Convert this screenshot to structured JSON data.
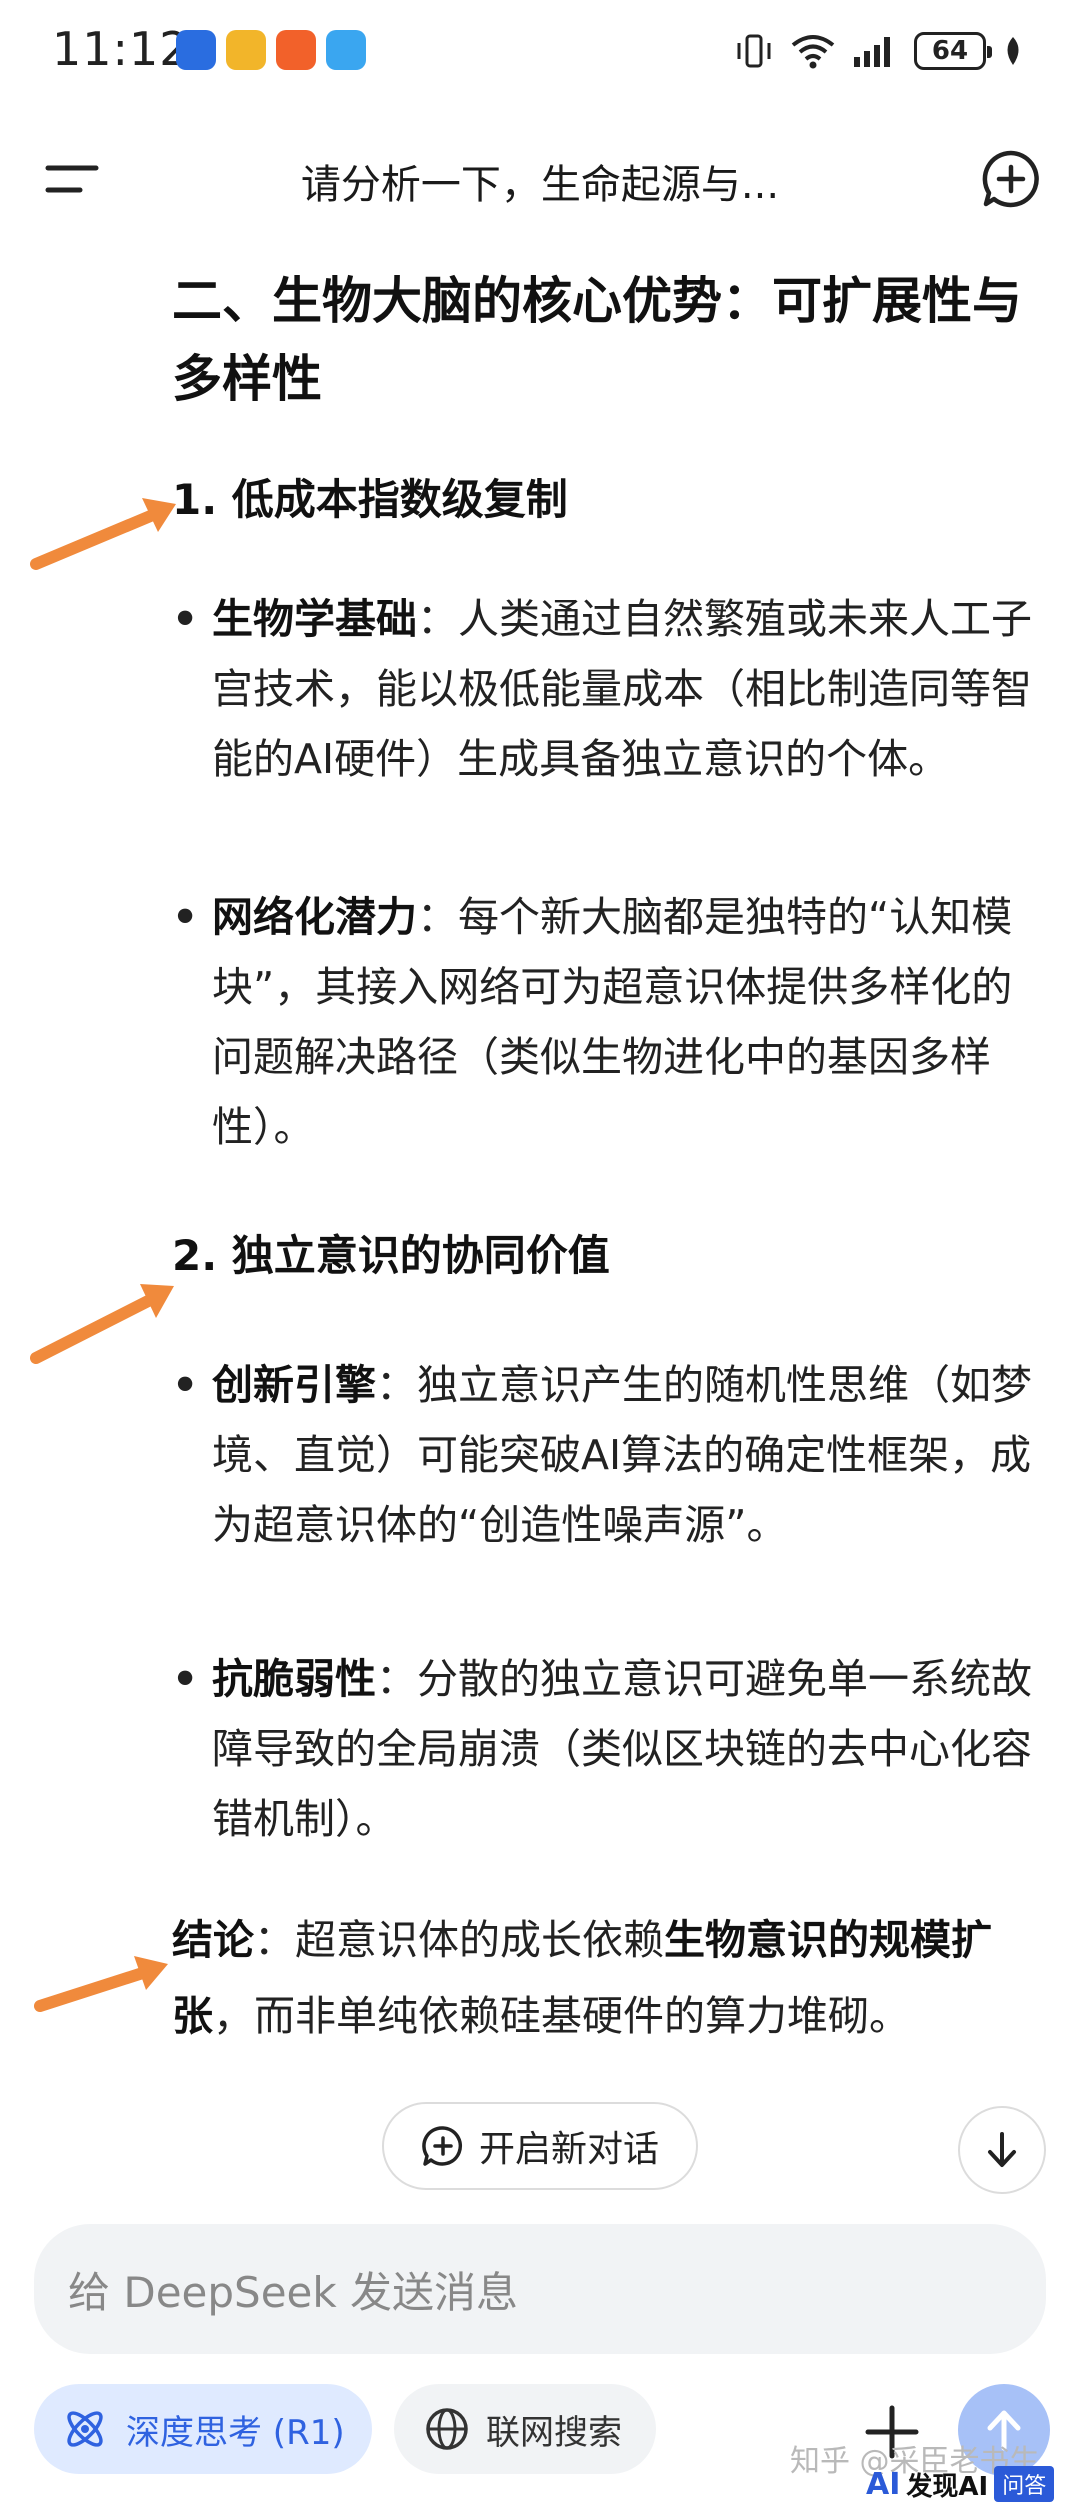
{
  "status_bar": {
    "time": "11:12",
    "battery": "64"
  },
  "header": {
    "title": "请分析一下，生命起源与..."
  },
  "section": {
    "title": "二、生物大脑的核心优势：可扩展性与多样性",
    "sub1": {
      "title": "1. 低成本指数级复制",
      "bullets": [
        {
          "bold": "生物学基础",
          "text": "：人类通过自然繁殖或未来人工子宫技术，能以极低能量成本（相比制造同等智能的AI硬件）生成具备独立意识的个体。"
        },
        {
          "bold": "网络化潜力",
          "text": "：每个新大脑都是独特的“认知模块”，其接入网络可为超意识体提供多样化的问题解决路径（类似生物进化中的基因多样性）。"
        }
      ]
    },
    "sub2": {
      "title": "2. 独立意识的协同价值",
      "bullets": [
        {
          "bold": "创新引擎",
          "text": "：独立意识产生的随机性思维（如梦境、直觉）可能突破AI算法的确定性框架，成为超意识体的“创造性噪声源”。"
        },
        {
          "bold": "抗脆弱性",
          "text": "：分散的独立意识可避免单一系统故障导致的全局崩溃（类似区块链的去中心化容错机制）。"
        }
      ]
    },
    "conclusion": {
      "label": "结论",
      "text_a": "：超意识体的成长依赖",
      "bold": "生物意识的规模扩张",
      "text_b": "，而非单纯依赖硅基硬件的算力堆砌。"
    }
  },
  "new_dialog_label": "开启新对话",
  "input": {
    "placeholder": "给 DeepSeek 发送消息"
  },
  "bottom": {
    "deep_think_label": "深度思考 (R1)",
    "web_search_label": "联网搜索"
  },
  "watermark": {
    "text": "知乎 @采臣老书生",
    "logo_ai": "AI",
    "logo_name": "发现AI",
    "logo_badge": "问答"
  },
  "colors": {
    "accent": "#2f62e0",
    "arrow": "#f08a3c",
    "chip_deep_bg": "#dfeaff",
    "send_bg": "#a7c1f7"
  },
  "icons": {
    "menu": "menu-icon",
    "new_chat": "new-chat-icon",
    "new_dialog": "chat-plus-icon",
    "scroll_down": "arrow-down-icon",
    "deep_think": "atom-icon",
    "web_search": "globe-icon",
    "plus": "plus-icon",
    "send": "arrow-up-icon"
  }
}
